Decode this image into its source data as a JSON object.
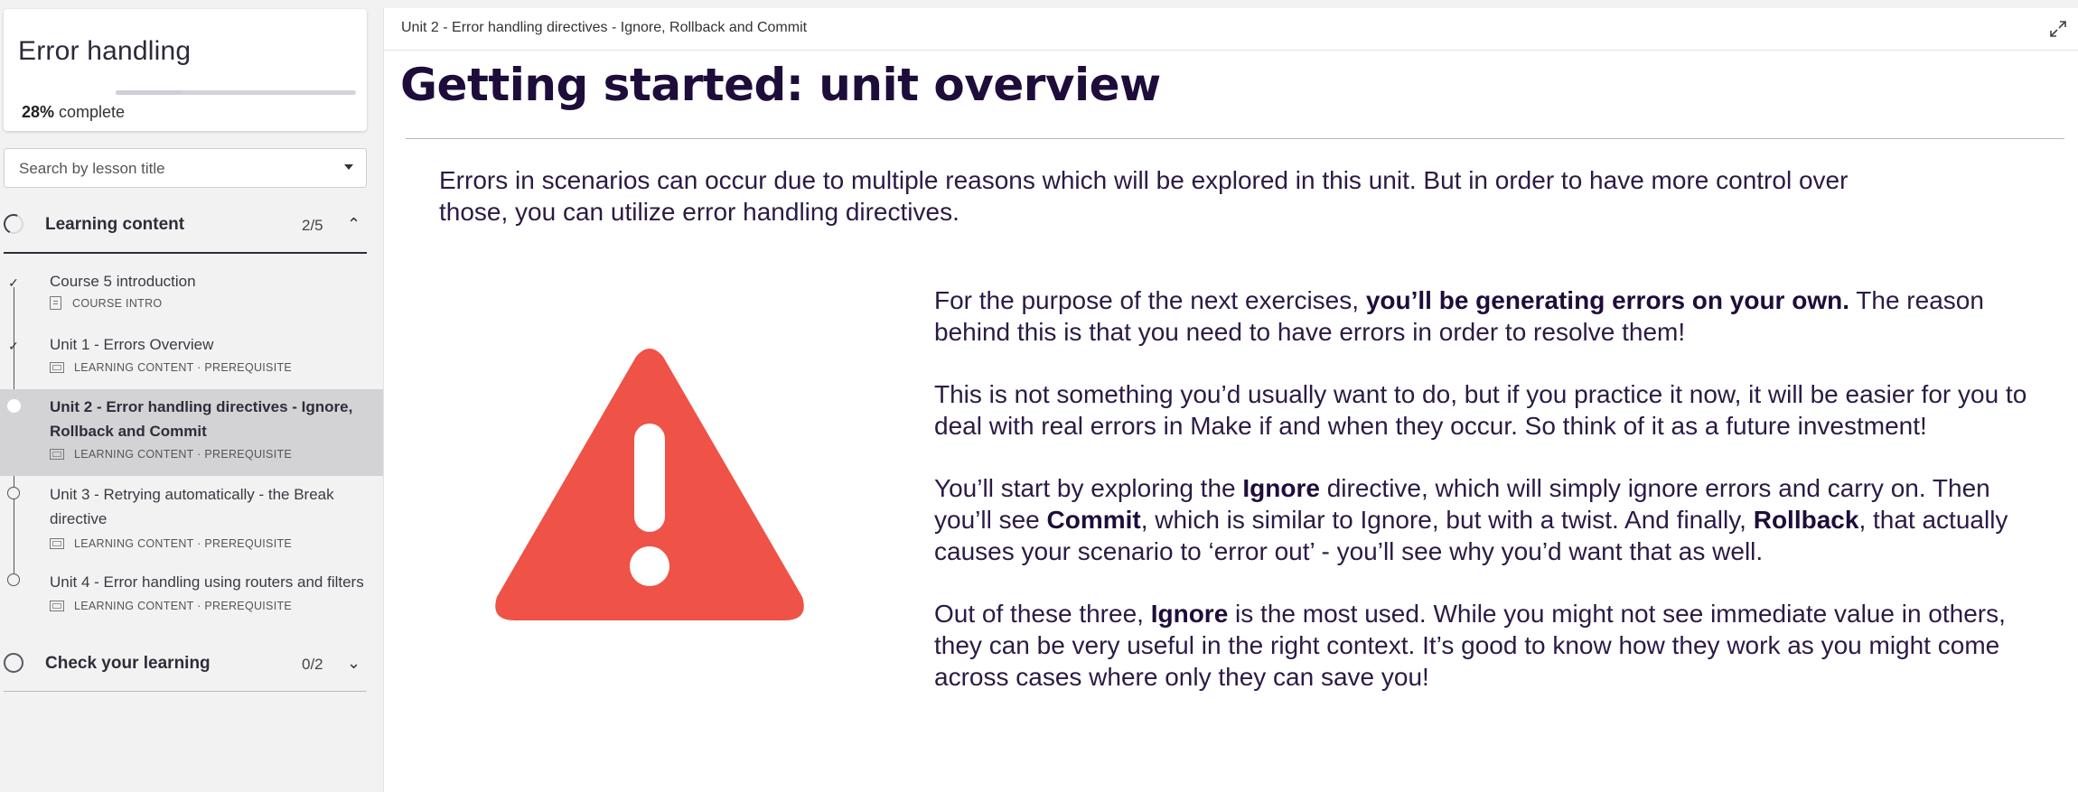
{
  "sidebar": {
    "course_title": "Error handling",
    "progress_percent": 28,
    "progress_value": "28%",
    "progress_suffix": " complete",
    "search": {
      "placeholder": "Search by lesson title"
    },
    "sections": [
      {
        "label": "Learning content",
        "count": "2/5",
        "expanded": true,
        "lessons": [
          {
            "title": "Course 5 introduction",
            "meta": "COURSE INTRO",
            "status": "done"
          },
          {
            "title": "Unit 1 - Errors Overview",
            "meta": "LEARNING CONTENT · PREREQUISITE",
            "status": "done"
          },
          {
            "title": "Unit 2 - Error handling directives - Ignore, Rollback and Commit",
            "meta": "LEARNING CONTENT · PREREQUISITE",
            "status": "current"
          },
          {
            "title": "Unit 3 - Retrying automatically - the Break directive",
            "meta": "LEARNING CONTENT · PREREQUISITE",
            "status": "open"
          },
          {
            "title": "Unit 4 - Error handling using routers and filters",
            "meta": "LEARNING CONTENT · PREREQUISITE",
            "status": "open"
          }
        ]
      },
      {
        "label": "Check your learning",
        "count": "0/2",
        "expanded": false
      }
    ]
  },
  "main": {
    "breadcrumb": "Unit 2 - Error handling directives - Ignore, Rollback and Commit",
    "title": "Getting started: unit overview",
    "intro": "Errors in scenarios can occur due to multiple reasons which will be explored in this unit. But in order to have more control over those, you can utilize error handling directives.",
    "paragraphs": [
      {
        "p1_a": "For the purpose of the next exercises, ",
        "p1_b": "you’ll be generating errors on your own.",
        "p1_c": " The reason behind this is that you need to have errors in order to resolve them!"
      },
      {
        "text": "This is not something you’d usually want to do, but if you practice it now, it will be easier for you to deal with real errors in Make if and when they occur. So think of it as a future investment!"
      },
      {
        "a": "You’ll start by exploring the ",
        "b": "Ignore",
        "c": " directive, which will simply ignore errors and carry on. Then you’ll see ",
        "d": "Commit",
        "e": ", which is similar to Ignore, but with a twist. And finally, ",
        "f": "Rollback",
        "g": ", that actually causes your scenario to ‘error out’ - you’ll see why you’d want that as well."
      },
      {
        "a": "Out of these three, ",
        "b": "Ignore",
        "c": " is the most used. While you might not see immediate value in others, they can be very useful in the right context. It’s good to know how they work as you might come across cases where only they can save you!"
      }
    ]
  },
  "colors": {
    "title": "#1e0d3a",
    "body_text": "#2c1a44",
    "warning_red": "#ef5246",
    "active_lesson_bg": "#d3d3d6"
  },
  "icons": {
    "warning": "warning-triangle-icon",
    "expand": "expand-icon",
    "checkmark": "checkmark-icon"
  }
}
